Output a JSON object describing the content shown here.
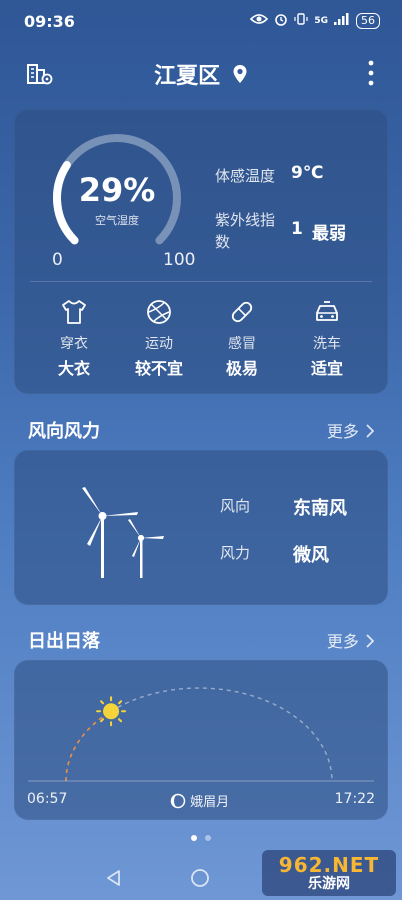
{
  "status_bar": {
    "time": "09:36",
    "network": "5G",
    "battery": "56"
  },
  "header": {
    "city": "江夏区"
  },
  "humidity": {
    "value": "29%",
    "label": "空气湿度",
    "fraction": 0.29,
    "min": "0",
    "max": "100"
  },
  "details": {
    "feels_like_label": "体感温度",
    "feels_like_value": "9℃",
    "uv_label_line1": "紫外线指",
    "uv_label_line2": "数",
    "uv_value": "1",
    "uv_level": "最弱"
  },
  "indices": [
    {
      "name": "穿衣",
      "value": "大衣",
      "icon": "shirt-icon"
    },
    {
      "name": "运动",
      "value": "较不宜",
      "icon": "ball-icon"
    },
    {
      "name": "感冒",
      "value": "极易",
      "icon": "pill-icon"
    },
    {
      "name": "洗车",
      "value": "适宜",
      "icon": "car-icon"
    }
  ],
  "wind": {
    "title": "风向风力",
    "more": "更多",
    "direction_label": "风向",
    "direction_value": "东南风",
    "force_label": "风力",
    "force_value": "微风"
  },
  "sun": {
    "title": "日出日落",
    "more": "更多",
    "sunrise": "06:57",
    "sunset": "17:22",
    "moon_phase": "娥眉月",
    "progress": 0.27
  },
  "pager": {
    "pages": 2,
    "active": 0
  },
  "watermark": {
    "line1": "962.NET",
    "line2": "乐游网"
  }
}
